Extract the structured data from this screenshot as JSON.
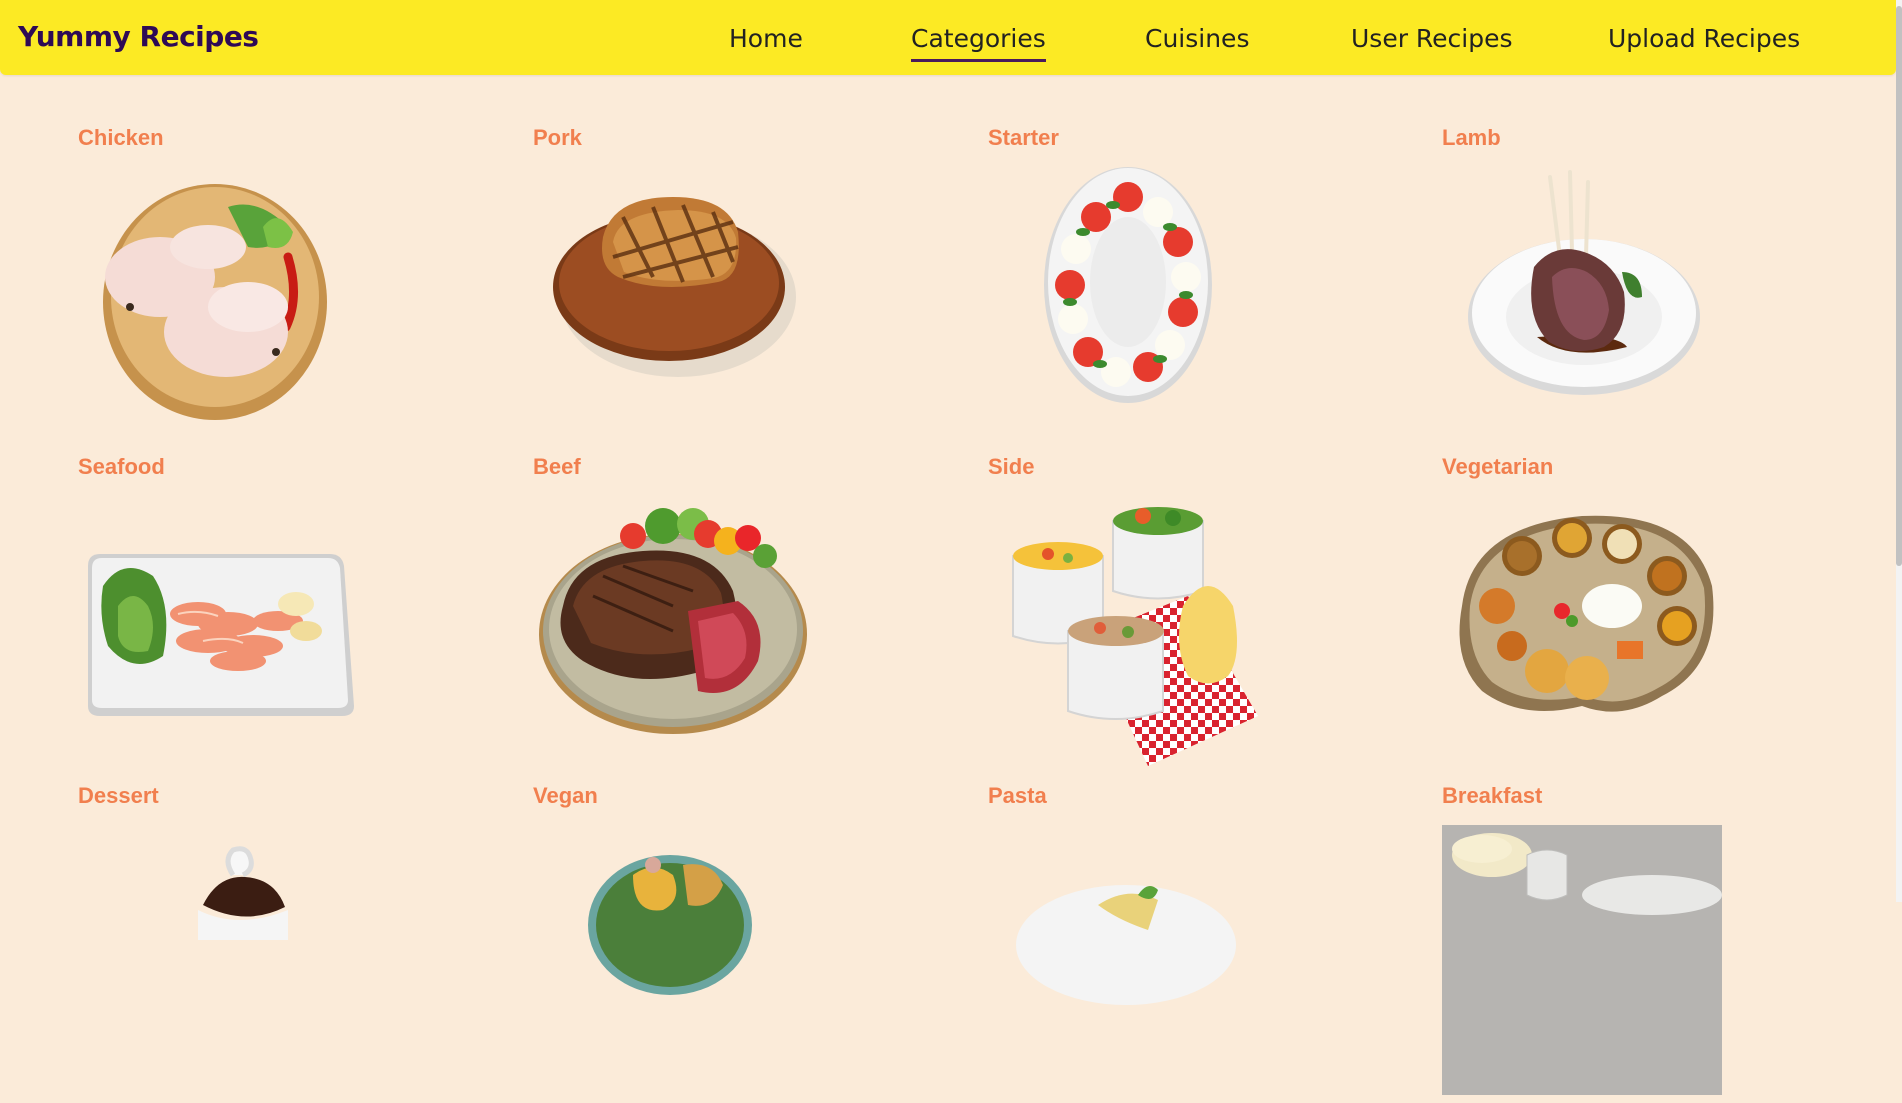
{
  "brand": "Yummy Recipes",
  "nav": {
    "home": "Home",
    "categories": "Categories",
    "cuisines": "Cuisines",
    "user_recipes": "User Recipes",
    "upload_recipes": "Upload Recipes",
    "active": "Categories"
  },
  "categories": [
    {
      "name": "Chicken",
      "icon": "chicken-dish-image"
    },
    {
      "name": "Pork",
      "icon": "pork-steak-image"
    },
    {
      "name": "Starter",
      "icon": "caprese-starter-image"
    },
    {
      "name": "Lamb",
      "icon": "lamb-chops-image"
    },
    {
      "name": "Seafood",
      "icon": "salmon-plate-image"
    },
    {
      "name": "Beef",
      "icon": "beef-steak-image"
    },
    {
      "name": "Side",
      "icon": "side-dishes-image"
    },
    {
      "name": "Vegetarian",
      "icon": "vegetarian-thali-image"
    },
    {
      "name": "Dessert",
      "icon": "dessert-image"
    },
    {
      "name": "Vegan",
      "icon": "vegan-bowl-image"
    },
    {
      "name": "Pasta",
      "icon": "pasta-image"
    },
    {
      "name": "Breakfast",
      "icon": "breakfast-image"
    }
  ],
  "colors": {
    "background": "#fbebd9",
    "navbar": "#fcea24",
    "brand": "#2e0a55",
    "category_title": "#f17f4e"
  }
}
